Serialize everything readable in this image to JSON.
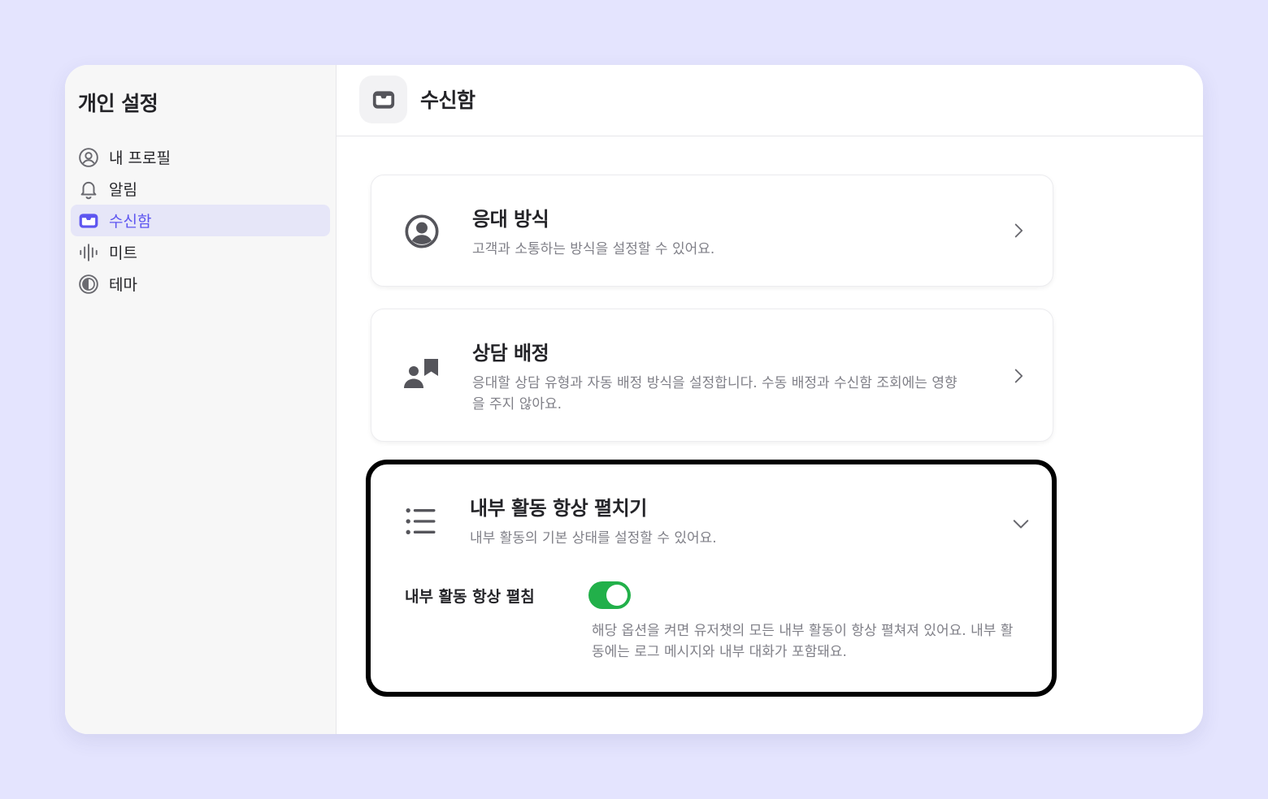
{
  "sidebar": {
    "title": "개인 설정",
    "items": [
      {
        "label": "내 프로필",
        "icon": "user-circle-icon",
        "active": false
      },
      {
        "label": "알림",
        "icon": "bell-icon",
        "active": false
      },
      {
        "label": "수신함",
        "icon": "inbox-icon",
        "active": true
      },
      {
        "label": "미트",
        "icon": "audio-wave-icon",
        "active": false
      },
      {
        "label": "테마",
        "icon": "contrast-icon",
        "active": false
      }
    ]
  },
  "header": {
    "icon": "inbox-icon",
    "title": "수신함"
  },
  "cards": [
    {
      "title": "응대 방식",
      "description": "고객과 소통하는 방식을 설정할 수 있어요.",
      "icon": "user-circle-icon"
    },
    {
      "title": "상담 배정",
      "description": "응대할 상담 유형과 자동 배정 방식을 설정합니다. 수동 배정과 수신함 조회에는 영향을 주지 않아요.",
      "icon": "person-bookmark-icon"
    },
    {
      "title": "내부 활동 항상 펼치기",
      "description": "내부 활동의 기본 상태를 설정할 수 있어요.",
      "icon": "list-icon",
      "expanded": true,
      "setting": {
        "label": "내부 활동 항상 펼침",
        "enabled": true,
        "description": "해당 옵션을 켜면 유저챗의 모든 내부 활동이 항상 펼쳐져 있어요. 내부 활동에는 로그 메시지와 내부 대화가 포함돼요."
      }
    }
  ],
  "colors": {
    "background": "#e4e4fe",
    "accent": "#5e56f0",
    "toggle_on": "#22b04a",
    "icon": "#5a5a60"
  }
}
